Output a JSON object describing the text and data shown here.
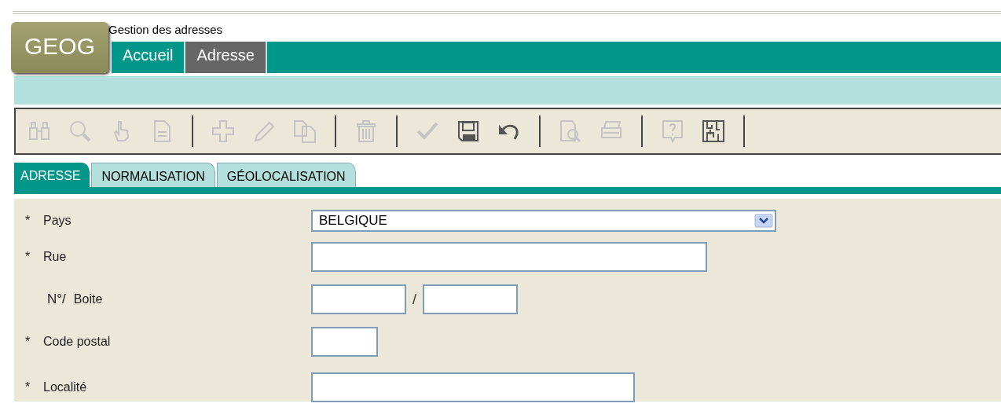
{
  "app": {
    "logo": "GEOG",
    "title": "Gestion des adresses"
  },
  "nav": [
    {
      "label": "Accueil",
      "selected": false
    },
    {
      "label": "Adresse",
      "selected": true
    }
  ],
  "toolbar": [
    [
      {
        "kind": "binoculars",
        "disabled": true
      },
      {
        "kind": "search",
        "disabled": true
      },
      {
        "kind": "hand",
        "disabled": true
      },
      {
        "kind": "document",
        "disabled": true
      }
    ],
    [
      {
        "kind": "plus",
        "disabled": true
      },
      {
        "kind": "pencil",
        "disabled": true
      },
      {
        "kind": "copy",
        "disabled": true
      }
    ],
    [
      {
        "kind": "trash",
        "disabled": true
      }
    ],
    [
      {
        "kind": "check",
        "disabled": true
      },
      {
        "kind": "save",
        "disabled": false
      },
      {
        "kind": "undo",
        "disabled": false
      }
    ],
    [
      {
        "kind": "preview",
        "disabled": true
      },
      {
        "kind": "print",
        "disabled": true
      }
    ],
    [
      {
        "kind": "help",
        "disabled": true
      },
      {
        "kind": "maze",
        "disabled": false
      }
    ]
  ],
  "tabs": [
    {
      "label": "ADRESSE",
      "selected": true
    },
    {
      "label": "NORMALISATION",
      "selected": false
    },
    {
      "label": "GÉOLOCALISATION",
      "selected": false
    }
  ],
  "form": [
    {
      "kind": "select",
      "marker": "*",
      "label": "Pays",
      "value": "BELGIQUE"
    },
    {
      "kind": "text",
      "marker": "*",
      "label": "Rue"
    },
    {
      "kind": "pair",
      "label_prefix": "N°/",
      "label": "Boite",
      "separator": "/"
    },
    {
      "kind": "text",
      "marker": "*",
      "label": "Code postal"
    },
    {
      "kind": "text",
      "marker": "*",
      "label": "Localité"
    }
  ]
}
